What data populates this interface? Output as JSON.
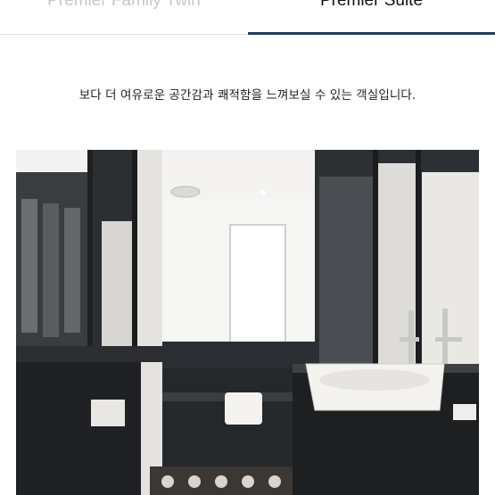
{
  "tabs": [
    {
      "label": "Premier Family Twin",
      "active": false
    },
    {
      "label": "Premier Suite",
      "active": true
    }
  ],
  "description": "보다 더 여유로운 공간감과 쾌적함을 느껴보실 수 있는 객실입니다.",
  "colors": {
    "active_tab_underline": "#1f3a5a",
    "inactive_tab_text": "#c7c7c7",
    "active_tab_text": "#111111"
  }
}
